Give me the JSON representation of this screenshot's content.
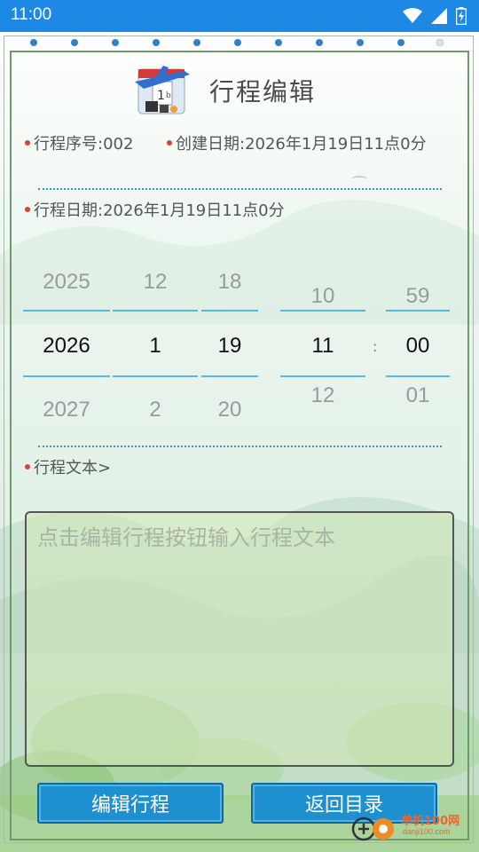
{
  "status_bar": {
    "time": "11:00"
  },
  "header": {
    "title": "行程编辑"
  },
  "info": {
    "serial_label": "行程序号:002",
    "created_label": "创建日期:2026年1月19日11点0分",
    "date_label": "行程日期:2026年1月19日11点0分"
  },
  "picker": {
    "year": {
      "prev": "2025",
      "current": "2026",
      "next": "2027"
    },
    "month": {
      "prev": "12",
      "current": "1",
      "next": "2"
    },
    "day": {
      "prev": "18",
      "current": "19",
      "next": "20"
    },
    "hour": {
      "prev": "10",
      "current": "11",
      "next": "12"
    },
    "minute": {
      "prev": "59",
      "current": "00",
      "next": "01"
    },
    "separator": ":"
  },
  "text_section": {
    "label": "行程文本>",
    "placeholder": "点击编辑行程按钮输入行程文本"
  },
  "buttons": {
    "edit": "编辑行程",
    "back": "返回目录"
  },
  "watermark": {
    "text": "单机100网",
    "sub": "danji100.com"
  },
  "colors": {
    "status_bar": "#1e88e5",
    "accent_blue": "#1e90d0",
    "bullet_red": "#e53935",
    "dotted_blue": "#3b8fd4"
  }
}
